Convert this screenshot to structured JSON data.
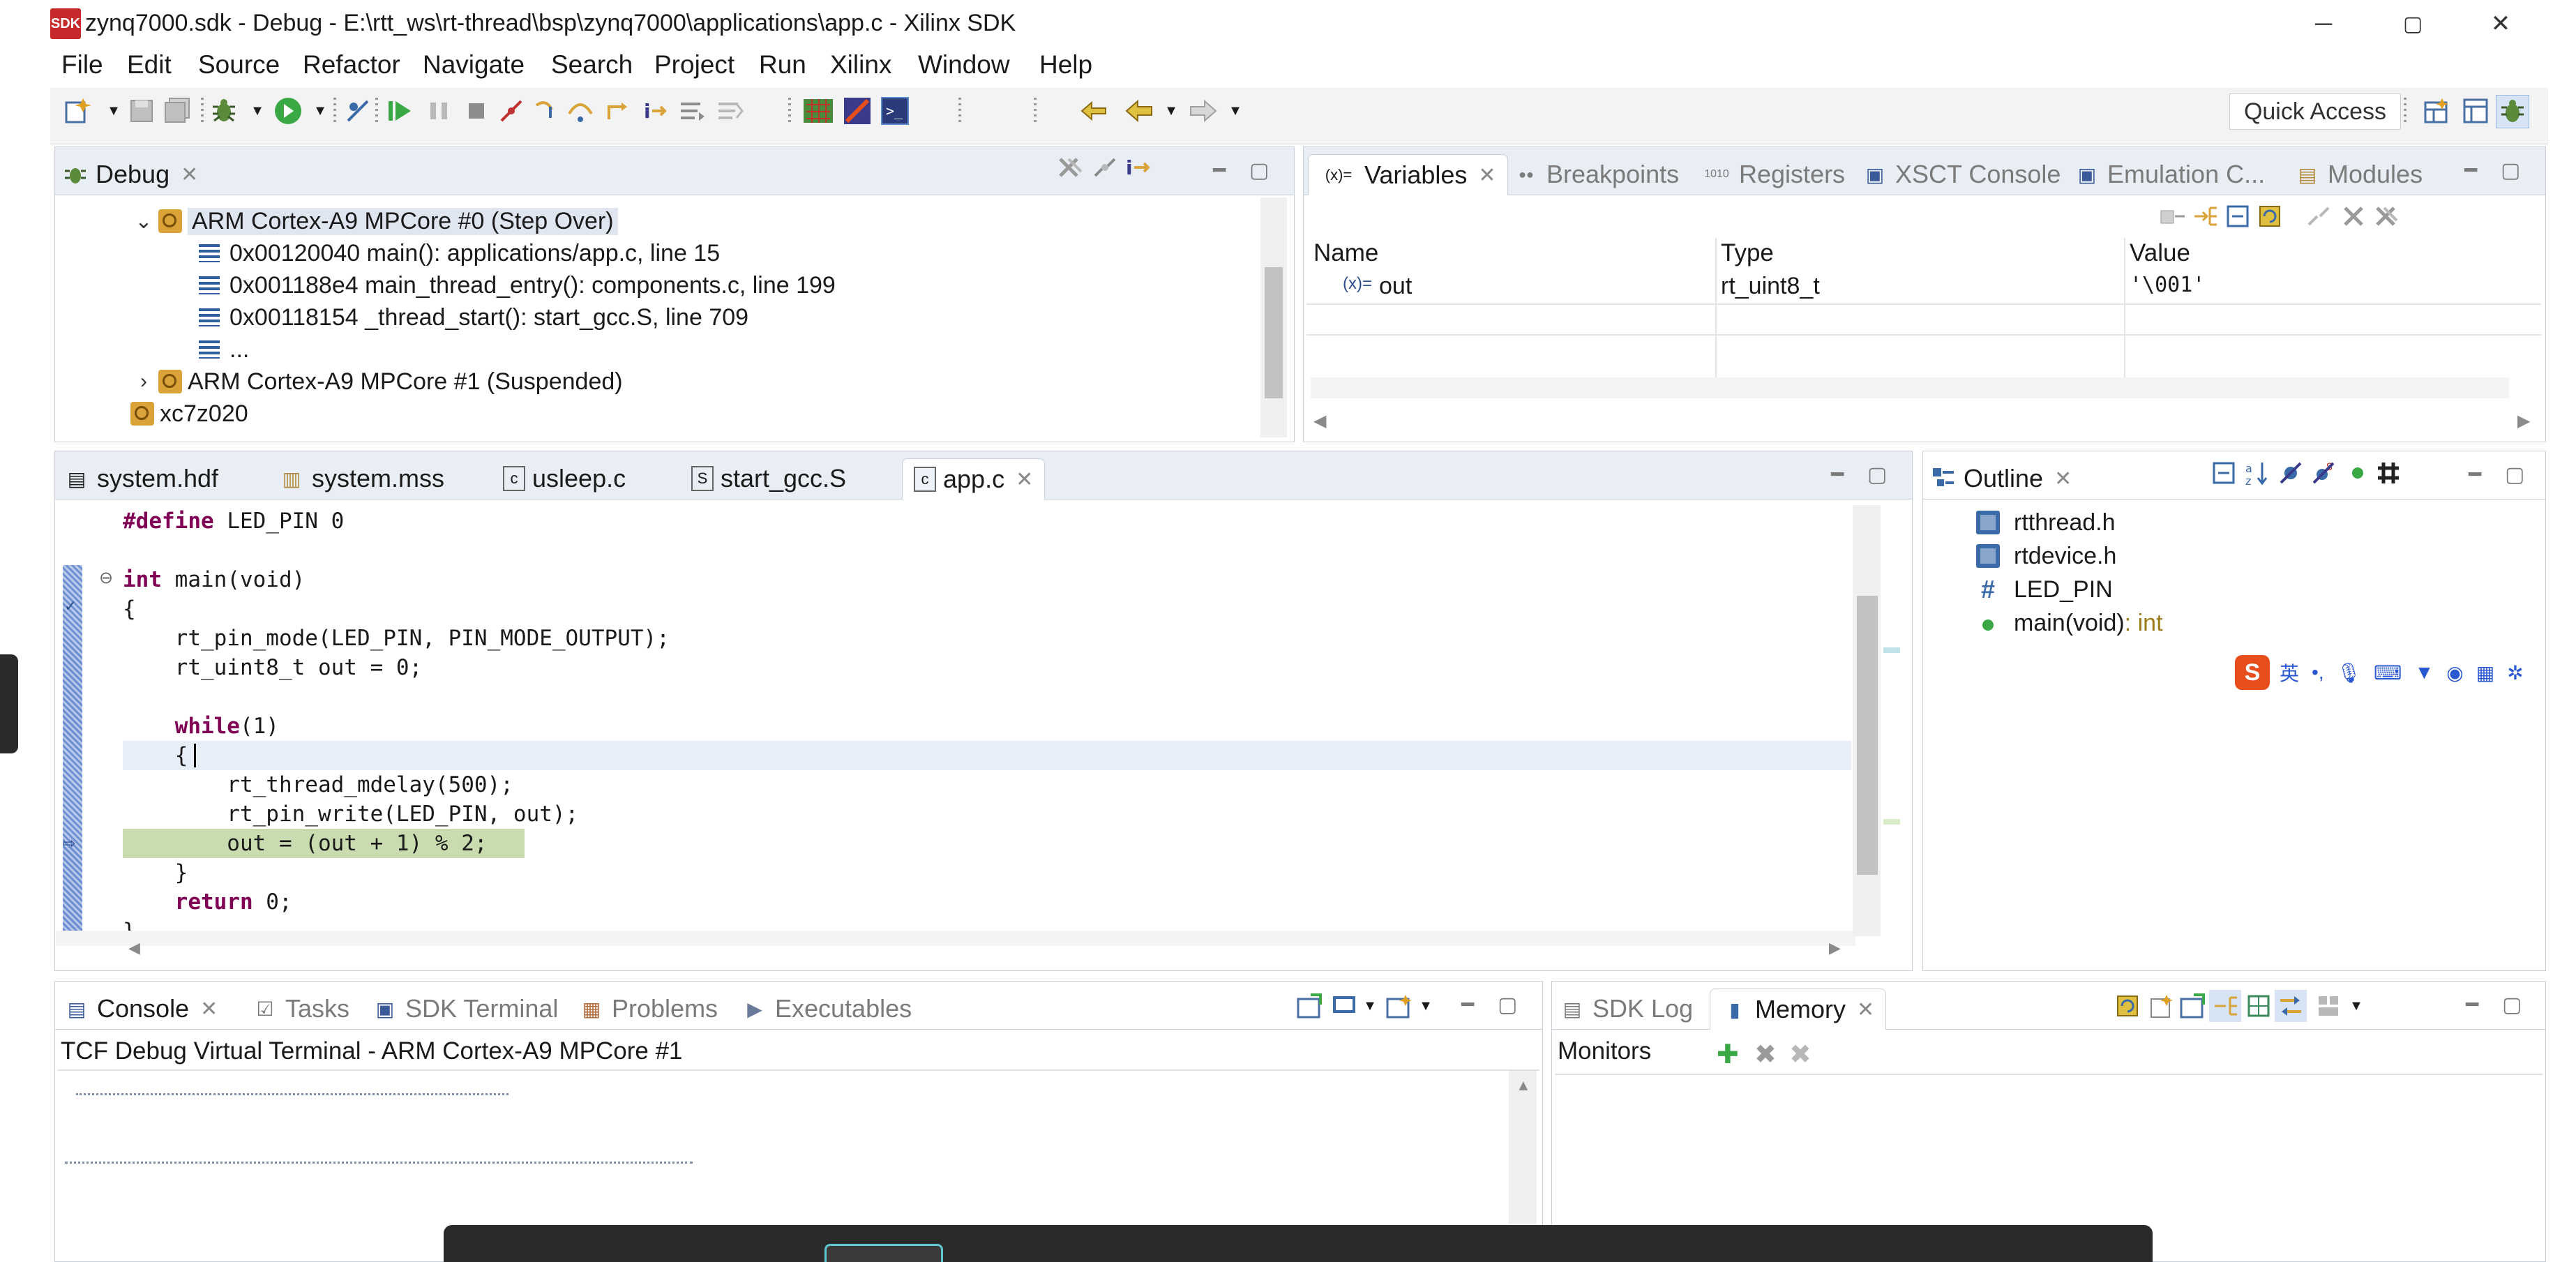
{
  "window": {
    "logo": "SDK",
    "title": "zynq7000.sdk - Debug - E:\\rtt_ws\\rt-thread\\bsp\\zynq7000\\applications\\app.c - Xilinx SDK",
    "minimize": "─",
    "restore": "▢",
    "close": "✕"
  },
  "menu": [
    "File",
    "Edit",
    "Source",
    "Refactor",
    "Navigate",
    "Search",
    "Project",
    "Run",
    "Xilinx",
    "Window",
    "Help"
  ],
  "toolbar": {
    "quick_access": "Quick Access"
  },
  "debug_panel": {
    "tab": "Debug",
    "rows": [
      "ARM Cortex-A9 MPCore #0 (Step Over)",
      "0x00120040 main(): applications/app.c, line 15",
      "0x001188e4 main_thread_entry(): components.c, line 199",
      "0x00118154 _thread_start(): start_gcc.S, line 709",
      "...",
      "ARM Cortex-A9 MPCore #1 (Suspended)",
      "xc7z020"
    ]
  },
  "variables_panel": {
    "tabs": [
      "Variables",
      "Breakpoints",
      "Registers",
      "XSCT Console",
      "Emulation C...",
      "Modules"
    ],
    "tab_icons": [
      "(x)=",
      "●●",
      "1010",
      "▣",
      "▣",
      "▤"
    ],
    "columns": [
      "Name",
      "Type",
      "Value"
    ],
    "rows": [
      {
        "icon": "(x)=",
        "name": "out",
        "type": "rt_uint8_t",
        "value": "'\\001'"
      }
    ]
  },
  "editor": {
    "tabs": [
      "system.hdf",
      "system.mss",
      "usleep.c",
      "start_gcc.S",
      "app.c"
    ],
    "tab_icons": [
      "▤",
      "▥",
      "c",
      "S",
      "c"
    ],
    "fold_marker": "⊖",
    "lines": [
      {
        "kw": "#define",
        "rest": " LED_PIN 0"
      },
      {
        "kw": "",
        "rest": ""
      },
      {
        "kw": "int",
        "rest": " main(void)"
      },
      {
        "kw": "",
        "rest": "{"
      },
      {
        "kw": "",
        "rest": "    rt_pin_mode(LED_PIN, PIN_MODE_OUTPUT);"
      },
      {
        "kw": "",
        "rest": "    rt_uint8_t out = 0;"
      },
      {
        "kw": "",
        "rest": ""
      },
      {
        "kw": "    while",
        "rest": "(1)"
      },
      {
        "kw": "",
        "rest": "    {"
      },
      {
        "kw": "",
        "rest": "        rt_thread_mdelay(500);"
      },
      {
        "kw": "",
        "rest": "        rt_pin_write(LED_PIN, out);"
      },
      {
        "kw": "",
        "rest": "        out = (out + 1) % 2;"
      },
      {
        "kw": "",
        "rest": "    }"
      },
      {
        "kw": "    return",
        "rest": " 0;"
      },
      {
        "kw": "",
        "rest": "}"
      }
    ]
  },
  "outline_panel": {
    "tab": "Outline",
    "items": [
      {
        "kind": "include",
        "label": "rtthread.h",
        "suffix": ""
      },
      {
        "kind": "include",
        "label": "rtdevice.h",
        "suffix": ""
      },
      {
        "kind": "macro",
        "label": "LED_PIN",
        "suffix": ""
      },
      {
        "kind": "function",
        "label": "main(void)",
        "suffix": " : int"
      }
    ],
    "macro_glyph": "#"
  },
  "ime": {
    "logo": "S",
    "lang": "英"
  },
  "console_panel": {
    "tabs": [
      "Console",
      "Tasks",
      "SDK Terminal",
      "Problems",
      "Executables"
    ],
    "tab_icons": [
      "▤",
      "☑",
      "▣",
      "▦",
      "▶"
    ],
    "header": "TCF Debug Virtual Terminal - ARM Cortex-A9 MPCore #1"
  },
  "memory_panel": {
    "tabs": [
      "SDK Log",
      "Memory"
    ],
    "tab_icons": [
      "▤",
      "▮"
    ],
    "monitors_label": "Monitors",
    "add_glyph": "✚",
    "remove_glyph": "✖",
    "remove_all_glyph": "✖"
  },
  "colors": {
    "accent": "#2e5e9e",
    "keyword": "#7f0055",
    "current_line": "#c8dcb0",
    "cursor_line": "#e8eef8",
    "panel_head": "#e9eef5",
    "dock": "#2a2a2a"
  }
}
